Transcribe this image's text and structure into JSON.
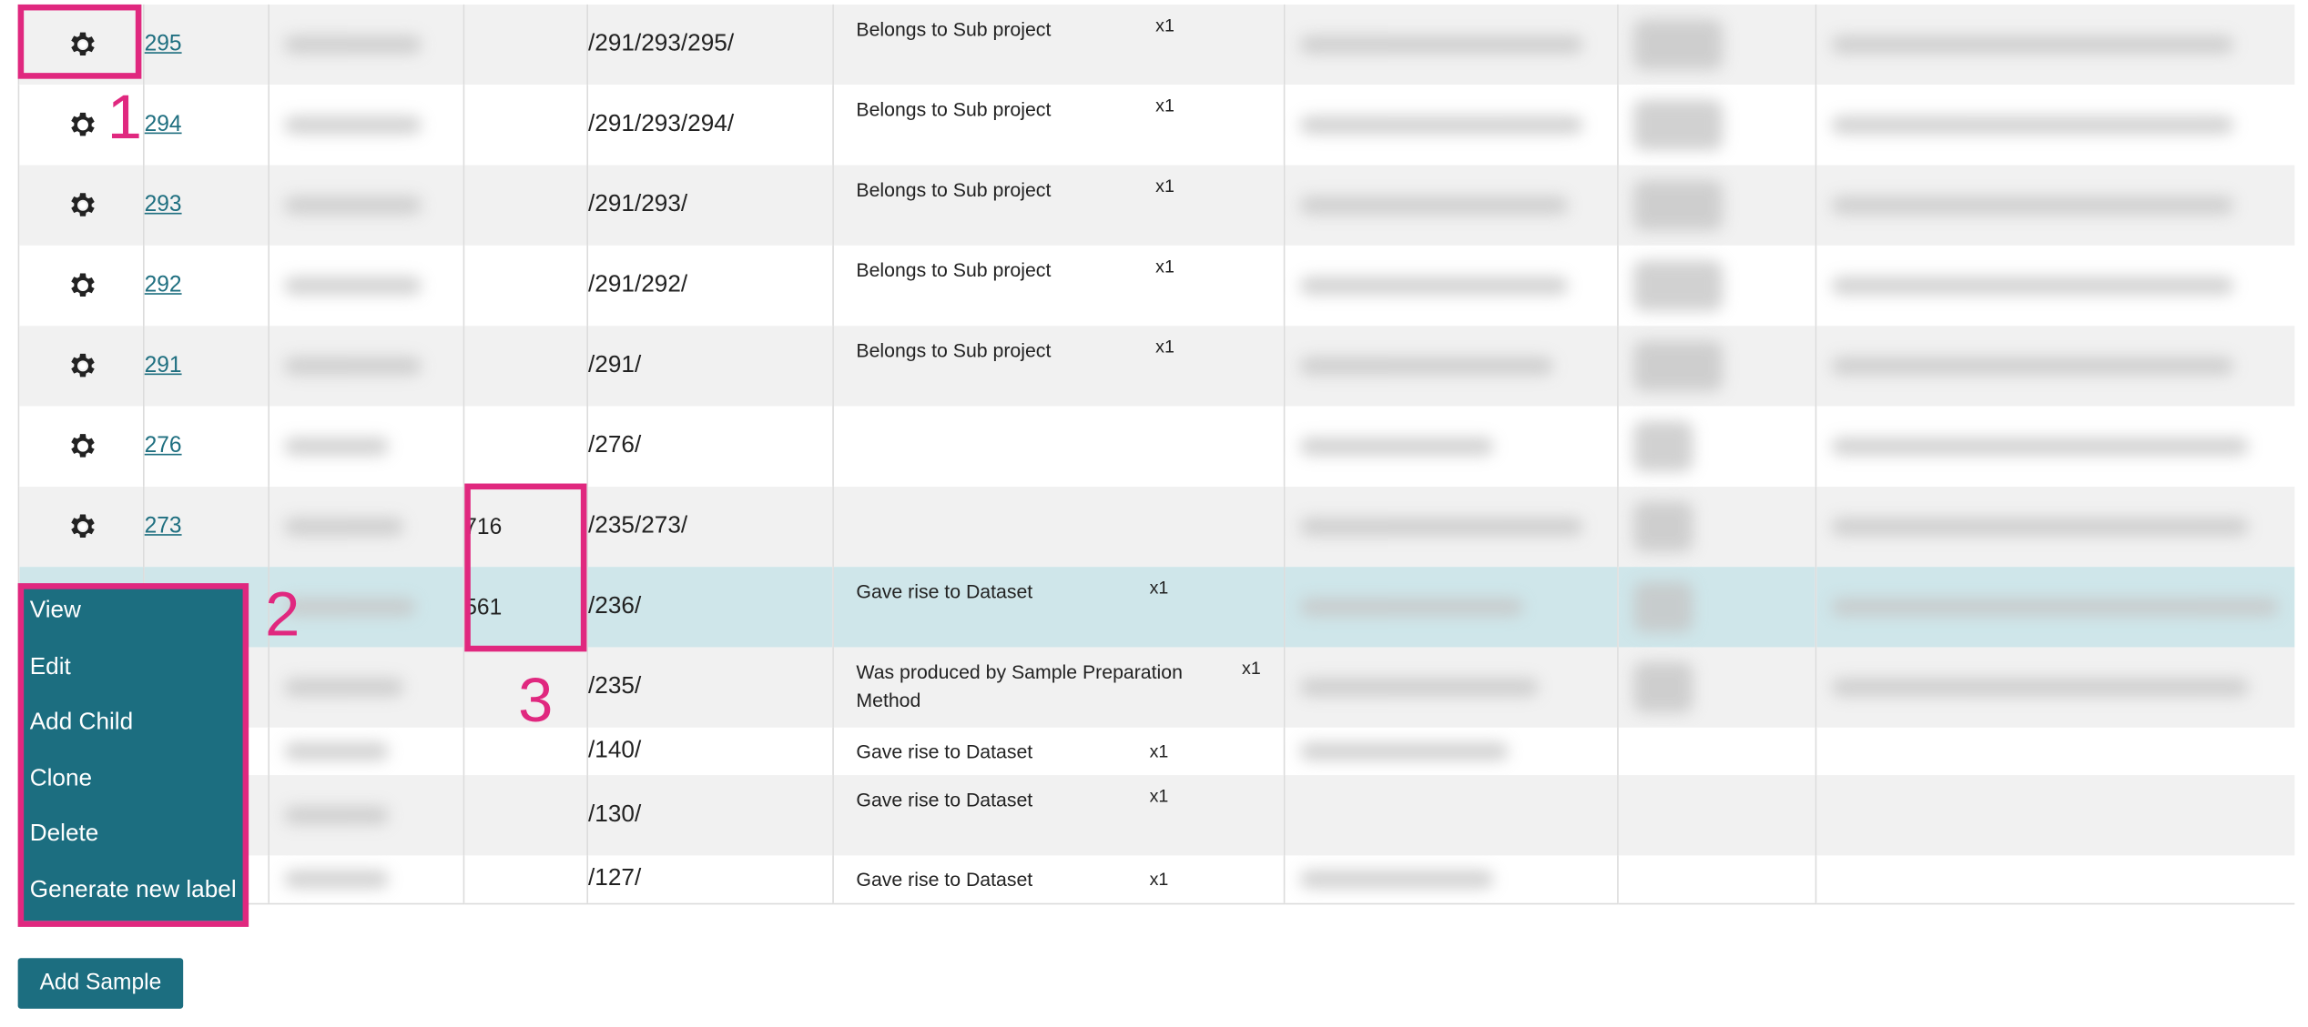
{
  "rows": [
    {
      "id": "295",
      "num": "",
      "path": "/291/293/295/",
      "relation": "Belongs to Sub project",
      "count": "x1",
      "gear": true
    },
    {
      "id": "294",
      "num": "",
      "path": "/291/293/294/",
      "relation": "Belongs to Sub project",
      "count": "x1",
      "gear": true
    },
    {
      "id": "293",
      "num": "",
      "path": "/291/293/",
      "relation": "Belongs to Sub project",
      "count": "x1",
      "gear": true
    },
    {
      "id": "292",
      "num": "",
      "path": "/291/292/",
      "relation": "Belongs to Sub project",
      "count": "x1",
      "gear": true
    },
    {
      "id": "291",
      "num": "",
      "path": "/291/",
      "relation": "Belongs to Sub project",
      "count": "x1",
      "gear": true
    },
    {
      "id": "276",
      "num": "",
      "path": "/276/",
      "relation": "",
      "count": "",
      "gear": true
    },
    {
      "id": "273",
      "num": "716",
      "path": "/235/273/",
      "relation": "",
      "count": "",
      "gear": true
    },
    {
      "id": "",
      "num": "561",
      "path": "/236/",
      "relation": "Gave rise to Dataset",
      "count": "x1",
      "gear": false
    },
    {
      "id": "",
      "num": "",
      "path": "/235/",
      "relation": "Was produced by Sample Preparation Method",
      "count": "x1",
      "gear": false
    },
    {
      "id": "",
      "num": "",
      "path": "/140/",
      "relation": "Gave rise to Dataset",
      "count": "x1",
      "gear": false
    },
    {
      "id": "",
      "num": "",
      "path": "/130/",
      "relation": "Gave rise to Dataset",
      "count": "x1",
      "gear": false
    },
    {
      "id": "",
      "num": "",
      "path": "/127/",
      "relation": "Gave rise to Dataset",
      "count": "x1",
      "gear": false
    }
  ],
  "menu": {
    "items": [
      "View",
      "Edit",
      "Add Child",
      "Clone",
      "Delete",
      "Generate new label"
    ]
  },
  "annotations": {
    "one": "1",
    "two": "2",
    "three": "3"
  },
  "add_sample_label": "Add Sample",
  "icons": {
    "row_actions": "gear-icon"
  },
  "colors": {
    "accent": "#1c6e80",
    "link": "#1f6f80",
    "annotation": "#e0287f",
    "selected_row": "#cfe6ea"
  }
}
